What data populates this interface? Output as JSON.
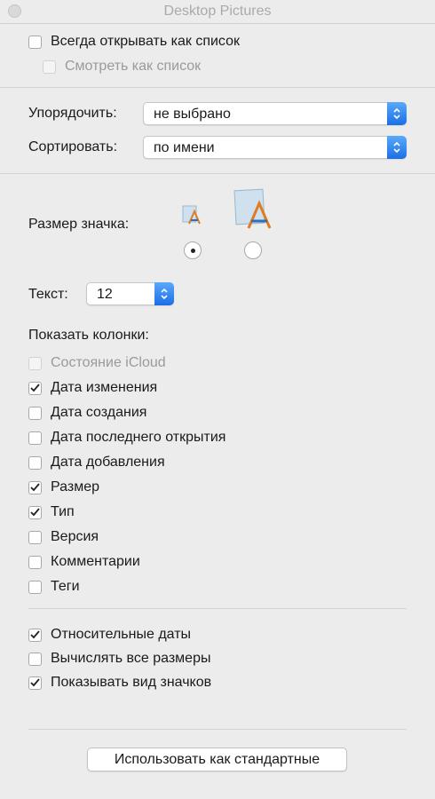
{
  "window": {
    "title": "Desktop Pictures"
  },
  "top_options": {
    "always_list": {
      "label": "Всегда открывать как список",
      "checked": false
    },
    "view_as_list": {
      "label": "Смотреть как список",
      "checked": false,
      "disabled": true
    }
  },
  "arrange": {
    "label": "Упорядочить:",
    "value": "не выбрано"
  },
  "sort": {
    "label": "Сортировать:",
    "value": "по имени"
  },
  "icon_size": {
    "label": "Размер значка:",
    "icons": [
      "small-app-icon",
      "large-app-icon"
    ],
    "selected": "small"
  },
  "text_size": {
    "label": "Текст:",
    "value": "12"
  },
  "columns": {
    "label": "Показать колонки:",
    "items": [
      {
        "label": "Состояние iCloud",
        "checked": false,
        "disabled": true
      },
      {
        "label": "Дата изменения",
        "checked": true
      },
      {
        "label": "Дата создания",
        "checked": false
      },
      {
        "label": "Дата последнего открытия",
        "checked": false
      },
      {
        "label": "Дата добавления",
        "checked": false
      },
      {
        "label": "Размер",
        "checked": true
      },
      {
        "label": "Тип",
        "checked": true
      },
      {
        "label": "Версия",
        "checked": false
      },
      {
        "label": "Комментарии",
        "checked": false
      },
      {
        "label": "Теги",
        "checked": false
      }
    ]
  },
  "bottom_options": [
    {
      "label": "Относительные даты",
      "checked": true
    },
    {
      "label": "Вычислять все размеры",
      "checked": false
    },
    {
      "label": "Показывать вид значков",
      "checked": true
    }
  ],
  "default_button": {
    "label": "Использовать как стандартные"
  },
  "colors": {
    "accent": "#1b6fe6",
    "background": "#ececec"
  }
}
